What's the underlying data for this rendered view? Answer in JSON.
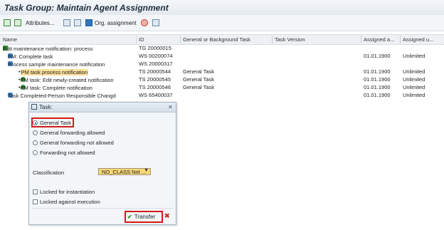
{
  "title": "Task Group: Maintain Agent Assignment",
  "toolbar": {
    "attributes_label": "Attributes...",
    "org_assignment_label": "Org. assignment"
  },
  "columns": {
    "name": "Name",
    "id": "ID",
    "task_type": "General or Background Task",
    "version": "Task Version",
    "assigned_a": "Assigned a...",
    "assigned_u": "Assigned u..."
  },
  "tree": [
    {
      "name": "Edit maintenance notification: process",
      "id": "TG 20000015",
      "type": "",
      "assigned_a": "",
      "assigned_u": ""
    },
    {
      "name": "PM: Complete task",
      "id": "WS 00200074",
      "type": "",
      "assigned_a": "01.01.1900",
      "assigned_u": "Unlimited"
    },
    {
      "name": "Process sample maintenance notification",
      "id": "WS 20000317",
      "type": "",
      "assigned_a": "",
      "assigned_u": ""
    },
    {
      "name": "PM task process notification",
      "id": "TS 20000544",
      "type": "General Task",
      "assigned_a": "01.01.1900",
      "assigned_u": "Unlimited"
    },
    {
      "name": "PM task: Edit newly-created notification",
      "id": "TS 20000545",
      "type": "General Task",
      "assigned_a": "01.01.1900",
      "assigned_u": "Unlimited"
    },
    {
      "name": "PM task: Complete notification",
      "id": "TS 20000546",
      "type": "General Task",
      "assigned_a": "01.01.1900",
      "assigned_u": "Unlimited"
    },
    {
      "name": "Task Completed-Person Responsible Changd",
      "id": "WS 65400037",
      "type": "",
      "assigned_a": "01.01.1900",
      "assigned_u": "Unlimited"
    }
  ],
  "dialog": {
    "title": "Task:",
    "options": [
      "General Task",
      "General forwarding allowed",
      "General forwarding not allowed",
      "Forwarding not allowed"
    ],
    "selected": "General Task",
    "classification_label": "Classification",
    "classification_value": "NO_CLASS Not ...",
    "locked_instantiation": "Locked for instantiation",
    "locked_execution": "Locked against execution",
    "transfer_label": "Transfer"
  },
  "colors": {
    "highlight": "#fbdf9a",
    "red_marker": "#d41b1b",
    "accent": "#1e2c3c"
  }
}
